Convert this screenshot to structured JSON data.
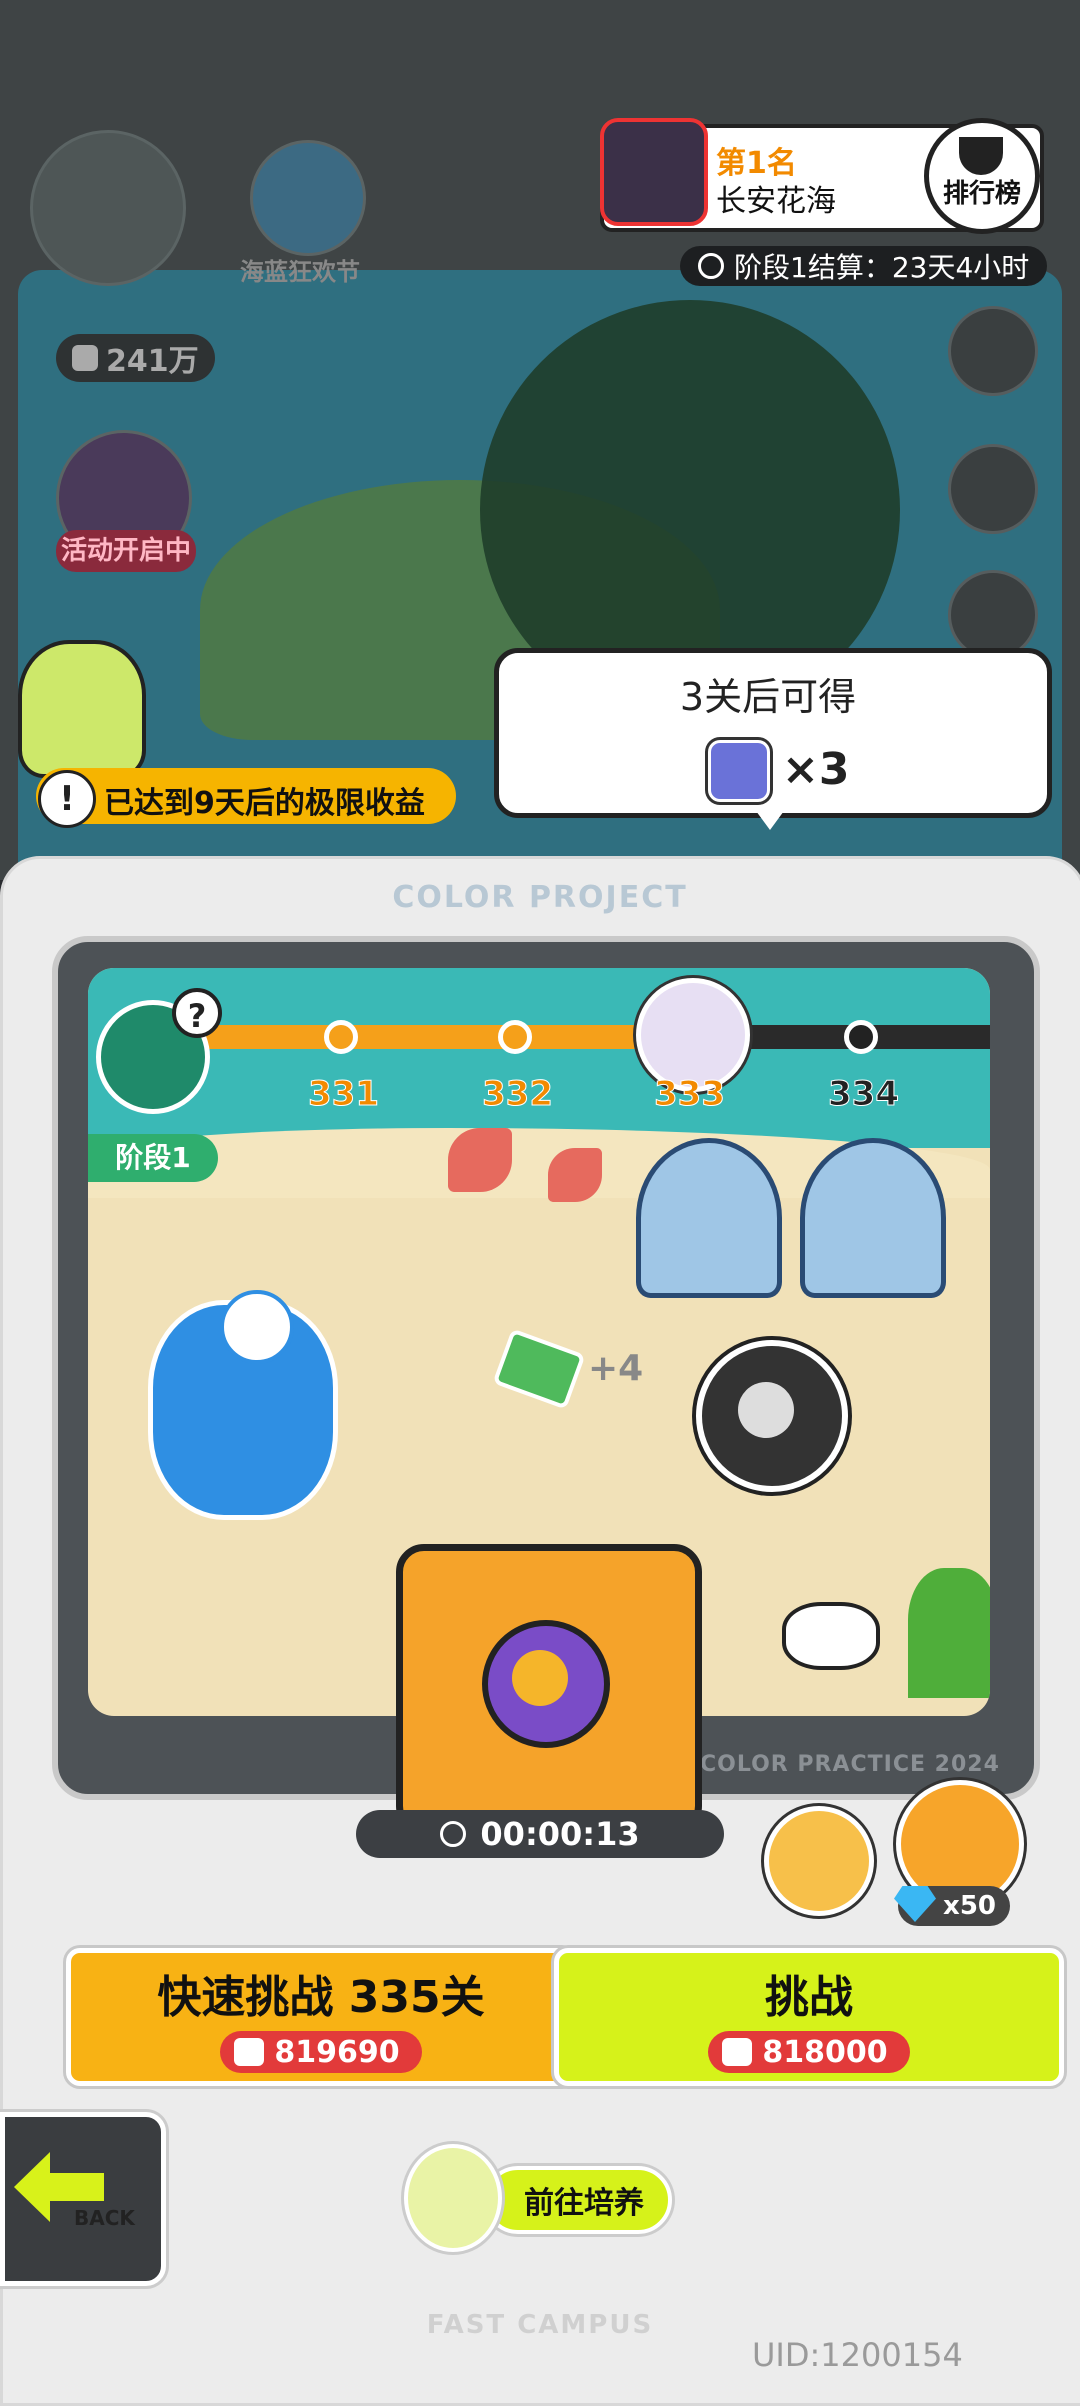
{
  "ranking": {
    "rank": "第1名",
    "player_name": "长安花海",
    "button_label": "排行榜",
    "stage_timer": "阶段1结算：23天4小时"
  },
  "background": {
    "event_label": "海蓝狂欢节",
    "power": "241万",
    "event_status": "活动开启中"
  },
  "bubble": {
    "title": "3关后可得",
    "item_count": "×3"
  },
  "limit_notice": {
    "icon": "!",
    "text": "已达到9天后的极限收益"
  },
  "panel": {
    "title": "COLOR PROJECT",
    "watermark": "COLOR PRACTICE 2024",
    "footer": "FAST CAMPUS",
    "uid": "UID:1200154"
  },
  "stage": {
    "help": "?",
    "tag": "阶段1",
    "levels": [
      "331",
      "332",
      "333",
      "334"
    ],
    "reward_text": "+4"
  },
  "safe": {
    "timer": "00:00:13"
  },
  "speedup": {
    "cost": "x50"
  },
  "buttons": {
    "quick": {
      "title": "快速挑战 335关",
      "cost": "819690"
    },
    "challenge": {
      "title": "挑战",
      "cost": "818000"
    },
    "train": "前往培养",
    "back": "BACK"
  },
  "colors": {
    "accent_orange": "#f8b214",
    "accent_lime": "#d6f21a",
    "cost_red": "#e23a3a"
  }
}
